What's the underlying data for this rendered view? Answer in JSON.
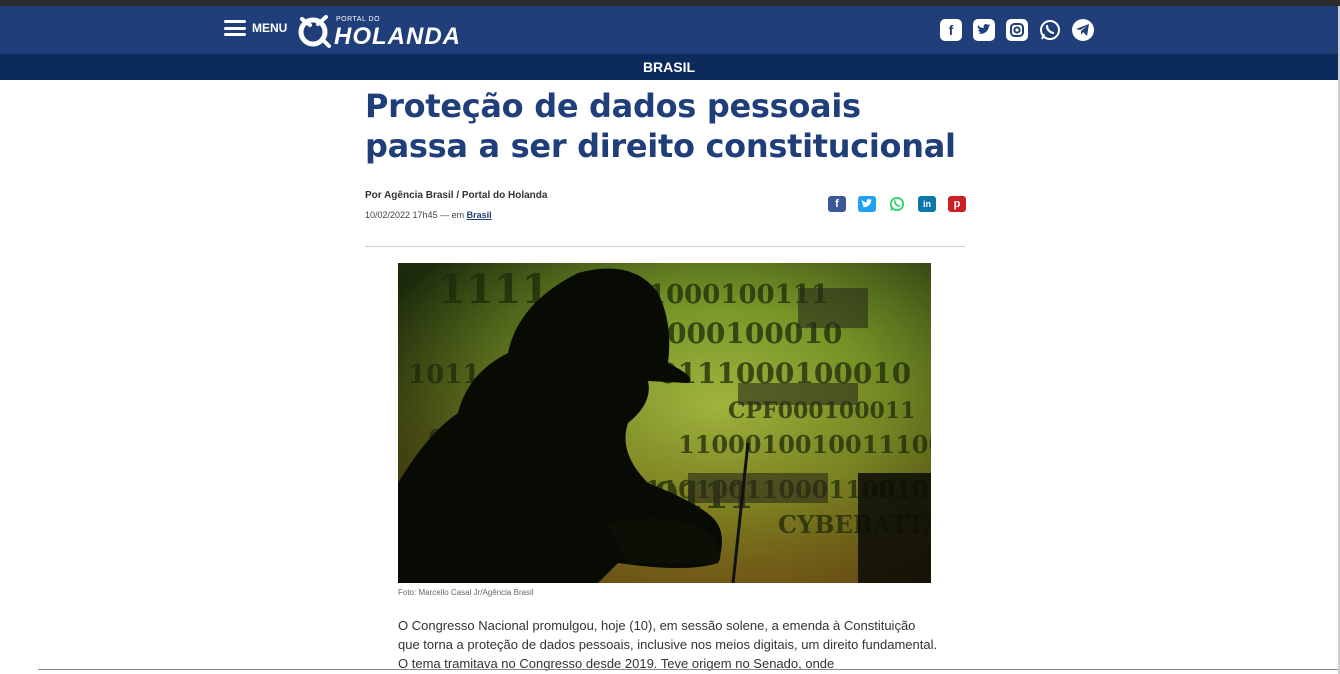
{
  "header": {
    "menu_label": "MENU",
    "logo_small": "PORTAL DO",
    "logo_big": "HOLANDA",
    "socials": [
      "facebook-icon",
      "twitter-icon",
      "instagram-icon",
      "whatsapp-icon",
      "telegram-icon"
    ]
  },
  "category": "BRASIL",
  "article": {
    "title": "Proteção de dados pessoais passa a ser direito constitucional",
    "byline": "Por Agência Brasil / Portal do Holanda",
    "date": "10/02/2022 17h45 — em",
    "section_link": "Brasil",
    "share": [
      {
        "name": "share-facebook-icon",
        "glyph": "f",
        "color": "#3b5998"
      },
      {
        "name": "share-twitter-icon",
        "glyph": "t",
        "color": "#1da1f2"
      },
      {
        "name": "share-whatsapp-icon",
        "glyph": "w",
        "color": "#25d366"
      },
      {
        "name": "share-linkedin-icon",
        "glyph": "in",
        "color": "#0e76a8"
      },
      {
        "name": "share-pinterest-icon",
        "glyph": "p",
        "color": "#cb2027"
      }
    ],
    "photo_caption": "Foto: Marcello Casal Jr/Agência Brasil",
    "body": "O Congresso Nacional promulgou, hoje (10), em sessão solene, a emenda à Constituição que torna a proteção de dados pessoais, inclusive nos meios digitais, um direito fundamental. O tema tramitava no Congresso desde 2019. Teve origem no Senado, onde"
  },
  "colors": {
    "header_bg": "#1f3e7a",
    "category_bg": "#0d2a5c",
    "title": "#1f3e7a"
  }
}
